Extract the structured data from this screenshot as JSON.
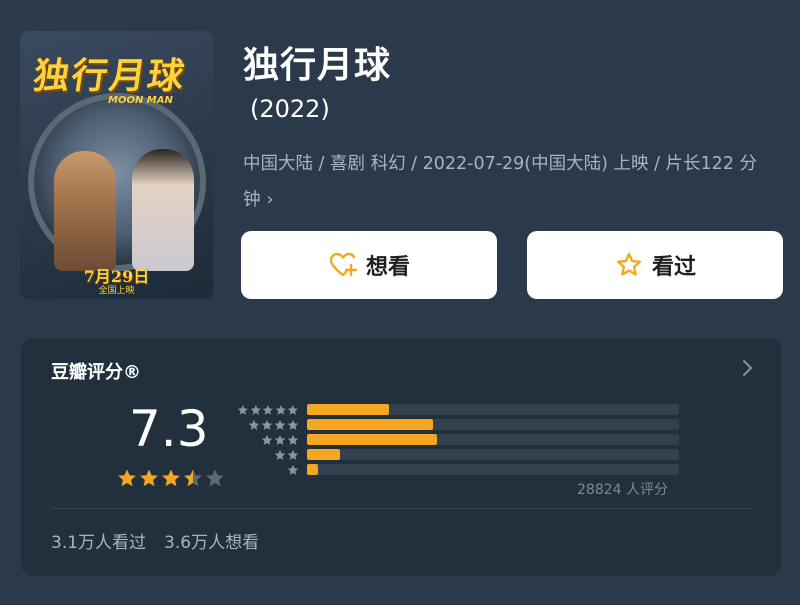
{
  "poster": {
    "title": "独行月球",
    "subtitle": "MOON MAN",
    "date": "7月29日",
    "release": "全国上映"
  },
  "movie": {
    "title": "独行月球",
    "year": "(2022)",
    "meta": "中国大陆 / 喜剧 科幻 / 2022-07-29(中国大陆) 上映 / 片长122 分钟",
    "meta_chevron": "›"
  },
  "actions": {
    "want_label": "想看",
    "want_icon": "heart-plus-icon",
    "seen_label": "看过",
    "seen_icon": "star-outline-icon"
  },
  "rating": {
    "source_label": "豆瓣评分®",
    "score": "7.3",
    "score_stars": 3.5,
    "distribution": [
      {
        "stars": 5,
        "fraction": 0.22
      },
      {
        "stars": 4,
        "fraction": 0.34
      },
      {
        "stars": 3,
        "fraction": 0.35
      },
      {
        "stars": 2,
        "fraction": 0.09
      },
      {
        "stars": 1,
        "fraction": 0.03
      }
    ],
    "count_text": "28824 人评分",
    "watched_text": "3.1万人看过",
    "want_text": "3.6万人想看"
  },
  "colors": {
    "background": "#2b3a4b",
    "card": "#22303e",
    "accent": "#f5a623",
    "muted": "#aab3bd"
  }
}
